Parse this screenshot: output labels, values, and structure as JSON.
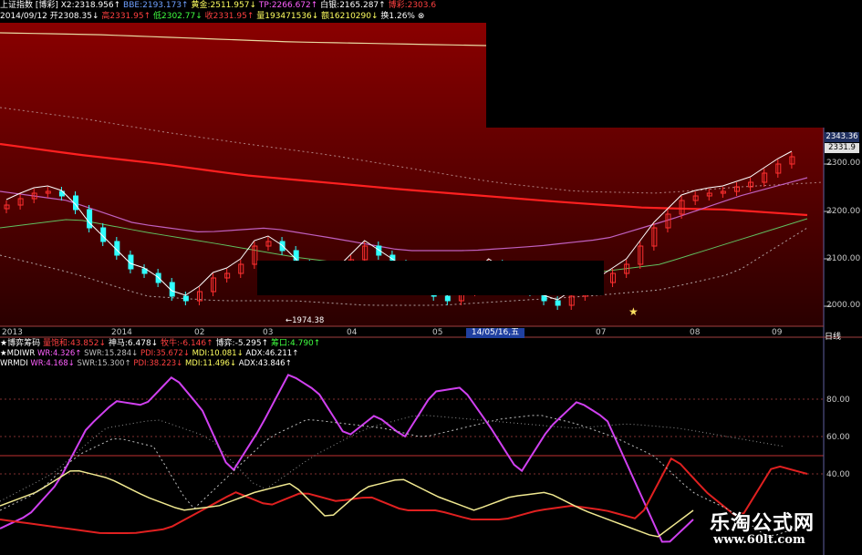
{
  "header": {
    "line1": [
      {
        "text": "上证指数",
        "cls": "w"
      },
      {
        "text": " [博彩] ",
        "cls": "w"
      },
      {
        "text": "X2:2318.956↑",
        "cls": "w"
      },
      {
        "text": " BBE:2193.173↑",
        "cls": "b"
      },
      {
        "text": " 黄金:2511.957↓",
        "cls": "y"
      },
      {
        "text": " TP:2266.672↑",
        "cls": "m"
      },
      {
        "text": " 白银:2165.287↑",
        "cls": "w"
      },
      {
        "text": " 博彩:2303.6",
        "cls": "r"
      }
    ],
    "line2": [
      {
        "text": "2014/09/12",
        "cls": "w"
      },
      {
        "text": " 开2308.35↓",
        "cls": "w"
      },
      {
        "text": " 高2331.95↑",
        "cls": "r"
      },
      {
        "text": " 低2302.77↓",
        "cls": "g"
      },
      {
        "text": " 收2331.95↑",
        "cls": "r"
      },
      {
        "text": " 量193471536↓",
        "cls": "y"
      },
      {
        "text": " 额16210290↓",
        "cls": "y"
      },
      {
        "text": " 换1.26%",
        "cls": "w"
      },
      {
        "text": " ⊗",
        "cls": "w"
      }
    ]
  },
  "price_axis": {
    "last_price": "2343.36",
    "current_price": "2331.9",
    "ticks": [
      "2300.00",
      "2200.00",
      "2100.00",
      "2000.00"
    ]
  },
  "low_marker": "1974.38",
  "dates": [
    "2013",
    "2014",
    "02",
    "03",
    "04",
    "05",
    "06",
    "07",
    "08",
    "09"
  ],
  "highlight_date": "14/05/16,五",
  "tab": "日线",
  "indicator_bar": [
    {
      "text": "★博弈筹码",
      "cls": "w"
    },
    {
      "text": " 量饱和:43.852↓",
      "cls": "r"
    },
    {
      "text": " 神马:6.478↓",
      "cls": "w"
    },
    {
      "text": " 牧牛:-6.146↑",
      "cls": "r"
    },
    {
      "text": " 博弈:-5.295↑",
      "cls": "w"
    },
    {
      "text": " 筹口:4.790↑",
      "cls": "g"
    }
  ],
  "dmi1": [
    {
      "text": "★MDIWR",
      "cls": "w"
    },
    {
      "text": " WR:4.326↑",
      "cls": "m"
    },
    {
      "text": " SWR:15.284↓",
      "cls": "gr"
    },
    {
      "text": " PDI:35.672↓",
      "cls": "r"
    },
    {
      "text": " MDI:10.081↓",
      "cls": "y"
    },
    {
      "text": " ADX:46.211↑",
      "cls": "w"
    }
  ],
  "dmi2": [
    {
      "text": "WRMDI",
      "cls": "w"
    },
    {
      "text": " WR:4.168↓",
      "cls": "m"
    },
    {
      "text": " SWR:15.300↑",
      "cls": "gr"
    },
    {
      "text": " PDI:38.223↓",
      "cls": "r"
    },
    {
      "text": " MDI:11.496↓",
      "cls": "y"
    },
    {
      "text": " ADX:43.846↑",
      "cls": "w"
    }
  ],
  "sub_ticks": [
    "80.00",
    "60.00",
    "40.00"
  ],
  "watermark": {
    "cn": "乐淘公式网",
    "url": "www.60lt.com"
  },
  "colors": {
    "candle_up": "#ff3030",
    "candle_down": "#30ffff",
    "bg_grad_top": "#8a0000",
    "bg_grad_bottom": "#200000",
    "wr": "#d040f0",
    "pdi": "#e02020",
    "mdi": "#f0e890"
  }
}
